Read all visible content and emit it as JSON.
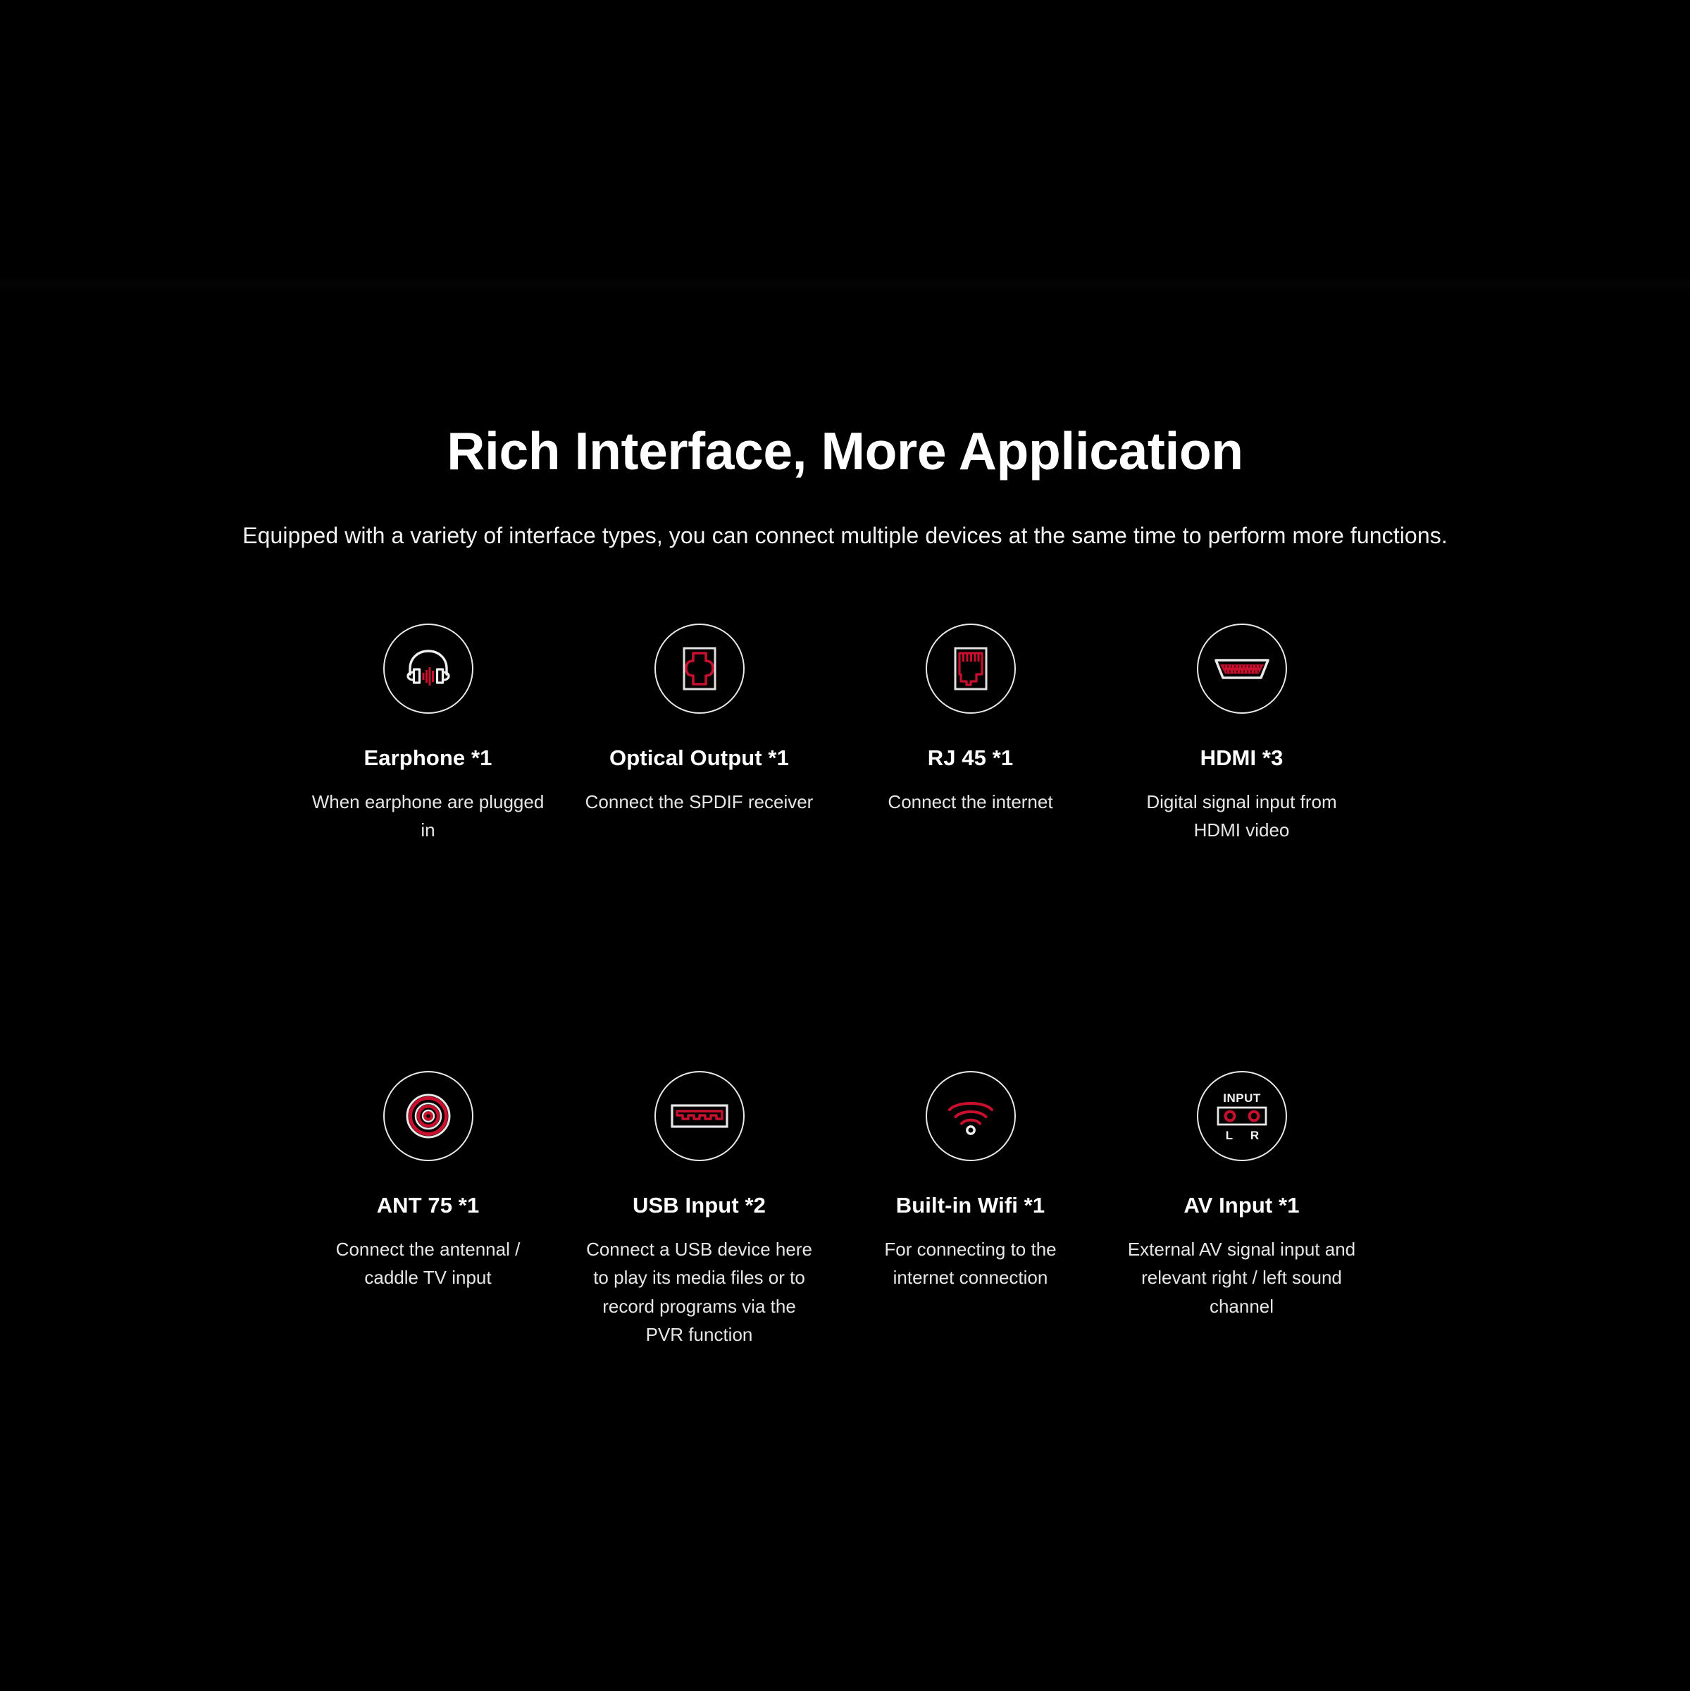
{
  "theme": {
    "background": "#000000",
    "text_primary": "#ffffff",
    "text_secondary": "#e6e6e6",
    "accent_red": "#C8102E",
    "outline_white": "#e8e8e8"
  },
  "header": {
    "title": "Rich Interface, More Application",
    "subtitle": "Equipped with a variety of interface types, you can connect multiple devices at the same time to perform more functions."
  },
  "features": [
    {
      "icon": "headphone-icon",
      "title": "Earphone *1",
      "description": "When earphone are plugged in"
    },
    {
      "icon": "optical-toslink-port-icon",
      "title": "Optical Output *1",
      "description": "Connect the SPDIF receiver"
    },
    {
      "icon": "rj45-ethernet-port-icon",
      "title": "RJ 45 *1",
      "description": "Connect the internet"
    },
    {
      "icon": "hdmi-port-icon",
      "title": "HDMI *3",
      "description": "Digital signal input from HDMI video"
    },
    {
      "icon": "coaxial-antenna-port-icon",
      "title": "ANT 75 *1",
      "description": "Connect the antennal / caddle TV input"
    },
    {
      "icon": "usb-port-icon",
      "title": "USB Input *2",
      "description": "Connect a USB device here to play its media files or to record programs via the PVR function"
    },
    {
      "icon": "wifi-icon",
      "title": "Built-in Wifi *1",
      "description": "For connecting to the internet connection"
    },
    {
      "icon": "av-input-rca-icon",
      "title": "AV Input *1",
      "description": "External AV signal input and relevant right / left sound channel"
    }
  ],
  "icon_labels": {
    "av_input_top": "INPUT",
    "av_input_left": "L",
    "av_input_right": "R"
  }
}
